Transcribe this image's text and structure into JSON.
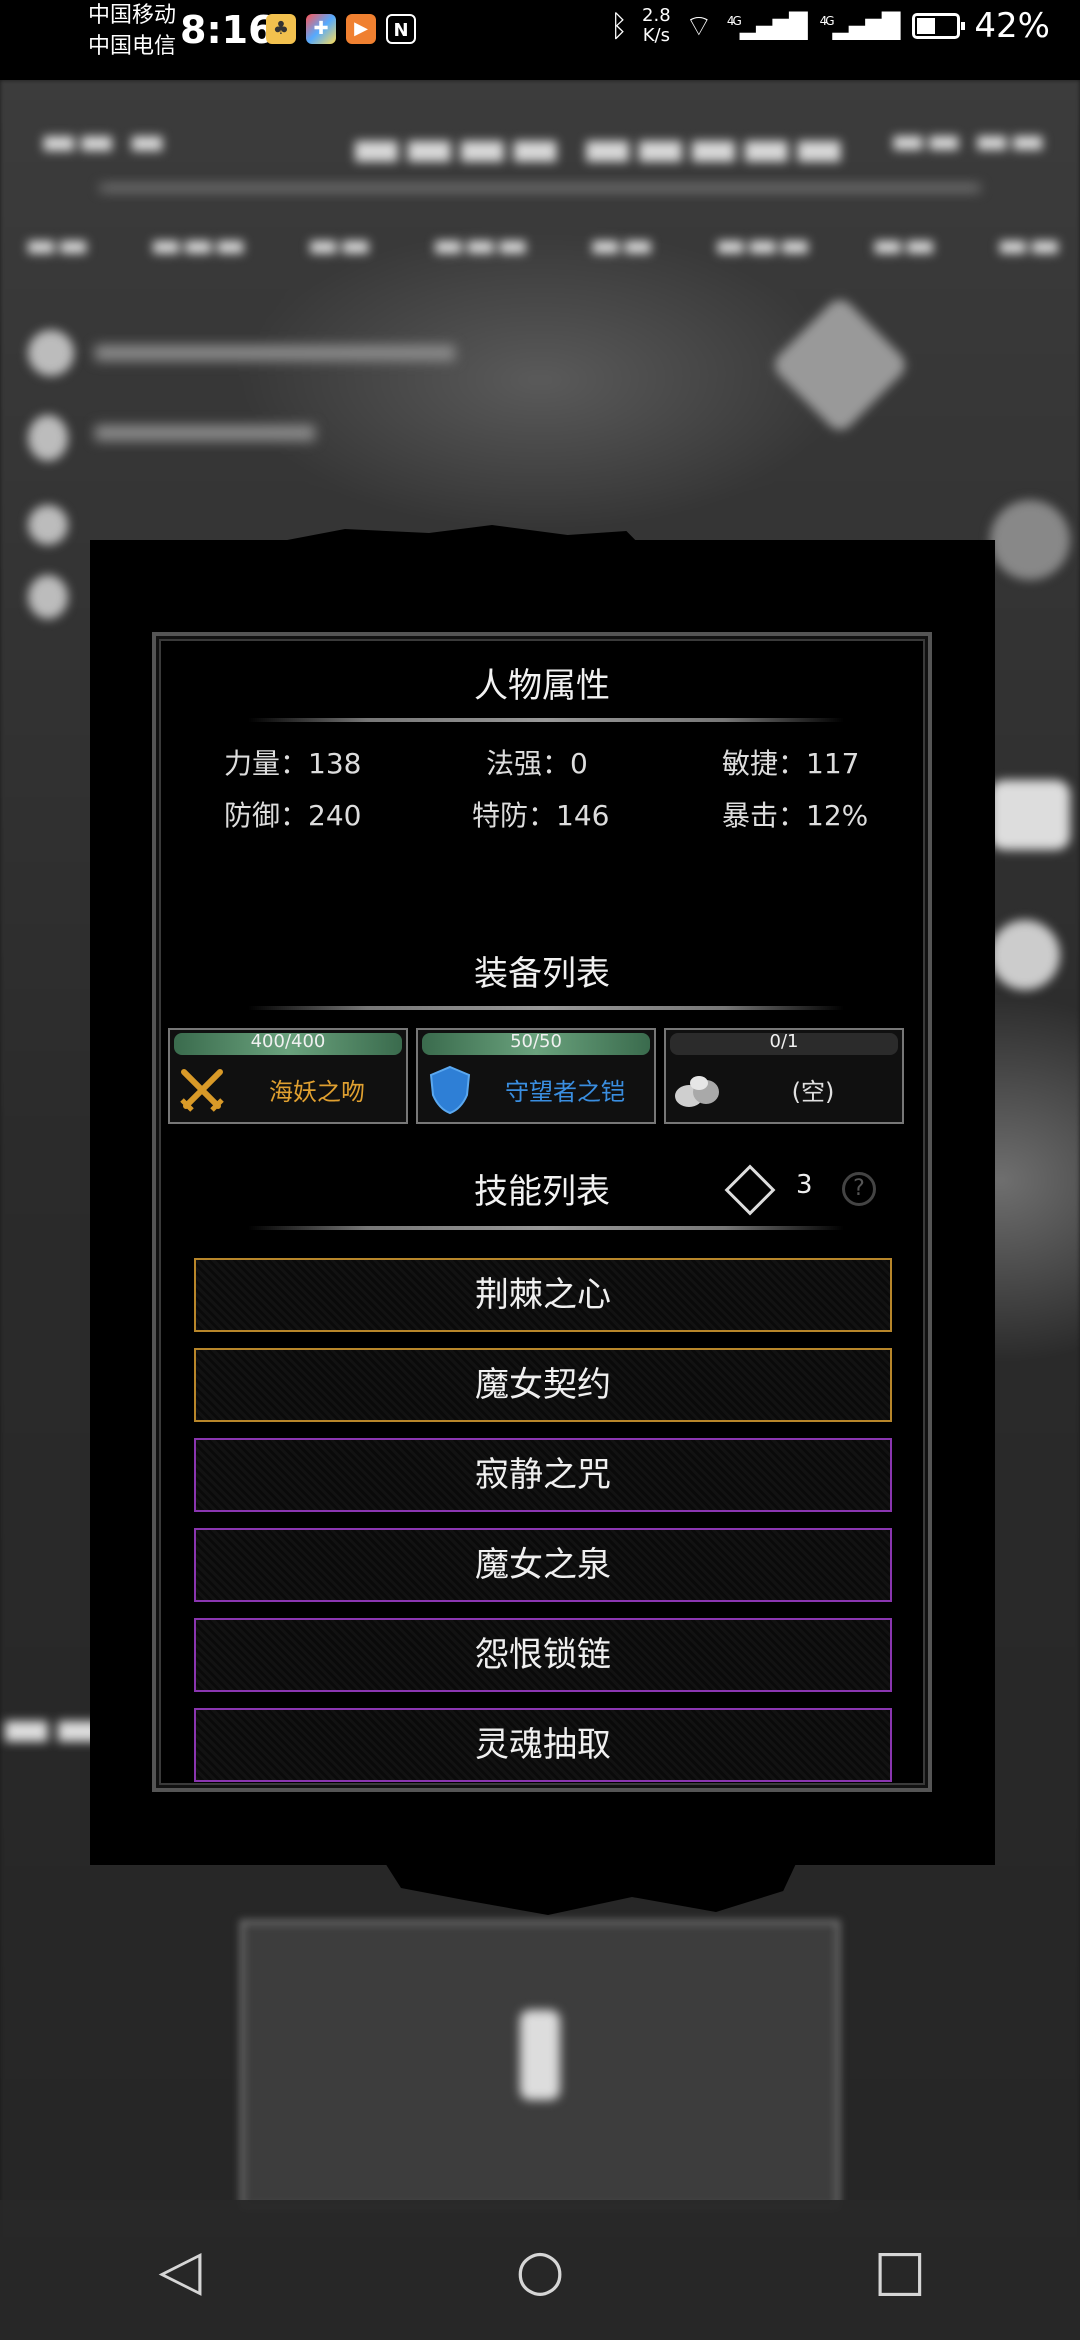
{
  "status_bar": {
    "carrier1": "中国移动",
    "carrier2": "中国电信",
    "time": "8:16",
    "net_speed": "2.8",
    "net_speed_unit": "K/s",
    "signal1": "4G",
    "signal2": "4G",
    "battery": "42%"
  },
  "modal": {
    "attributes_title": "人物属性",
    "attributes": [
      {
        "label": "力量：",
        "value": "138"
      },
      {
        "label": "法强：",
        "value": "0"
      },
      {
        "label": "敏捷：",
        "value": "117"
      },
      {
        "label": "防御：",
        "value": "240"
      },
      {
        "label": "特防：",
        "value": "146"
      },
      {
        "label": "暴击：",
        "value": "12%"
      }
    ],
    "equipment_title": "装备列表",
    "equipment": [
      {
        "durability": "400/400",
        "name": "海妖之吻",
        "icon": "crossed-swords-icon",
        "color": "#e0a030",
        "fill": 1.0
      },
      {
        "durability": "50/50",
        "name": "守望者之铠",
        "icon": "shield-icon",
        "color": "#3a8ee0",
        "fill": 1.0
      },
      {
        "durability": "0/1",
        "name": "(空)",
        "icon": "stones-icon",
        "color": "#e0e0e0",
        "fill": 0.0
      }
    ],
    "skills_title": "技能列表",
    "skill_points": "3",
    "skills": [
      {
        "name": "荆棘之心",
        "rarity": "gold"
      },
      {
        "name": "魔女契约",
        "rarity": "gold"
      },
      {
        "name": "寂静之咒",
        "rarity": "purple"
      },
      {
        "name": "魔女之泉",
        "rarity": "purple"
      },
      {
        "name": "怨恨锁链",
        "rarity": "purple"
      },
      {
        "name": "灵魂抽取",
        "rarity": "purple"
      }
    ]
  },
  "navigation": {
    "back": "◁",
    "home": "○",
    "recents": "□"
  }
}
